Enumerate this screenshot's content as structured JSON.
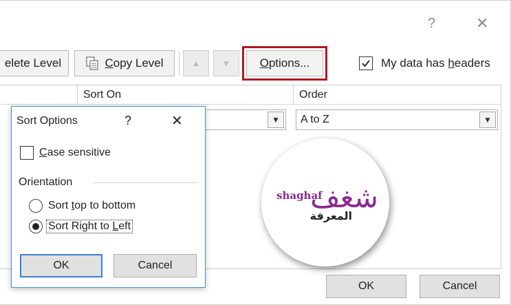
{
  "window": {
    "help_glyph": "?",
    "close_glyph": "✕"
  },
  "toolbar": {
    "delete_level": {
      "text": "elete Level",
      "accel": ""
    },
    "copy_level": {
      "pre": "",
      "accel": "C",
      "post": "opy Level"
    },
    "options": {
      "accel": "O",
      "post": "ptions..."
    },
    "headers_checkbox": {
      "pre": "My data has ",
      "accel": "h",
      "post": "eaders",
      "checked": true
    }
  },
  "grid": {
    "columns": [
      "Sort On",
      "Order"
    ],
    "order_value": "A to Z"
  },
  "footer": {
    "ok_label": "OK",
    "cancel_label": "Cancel"
  },
  "sort_options": {
    "title": "Sort Options",
    "help_glyph": "?",
    "close_glyph": "✕",
    "case_sensitive": {
      "accel": "C",
      "post": "ase sensitive",
      "checked": false
    },
    "orientation_label": "Orientation",
    "radio_top_bottom": {
      "pre": "Sort ",
      "accel": "t",
      "post": "op to bottom",
      "selected": false
    },
    "radio_right_left": {
      "pre": "Sort Right to ",
      "accel": "L",
      "post": "eft",
      "selected": true
    },
    "ok_label": "OK",
    "cancel_label": "Cancel"
  },
  "logo": {
    "latin": "shaghaf",
    "arabic_top": "شغف",
    "arabic_bottom": "المعرفة"
  },
  "colors": {
    "highlight_border": "#b0171f",
    "focus_border": "#3c7fd1",
    "logo_purple": "#8a2a93"
  }
}
